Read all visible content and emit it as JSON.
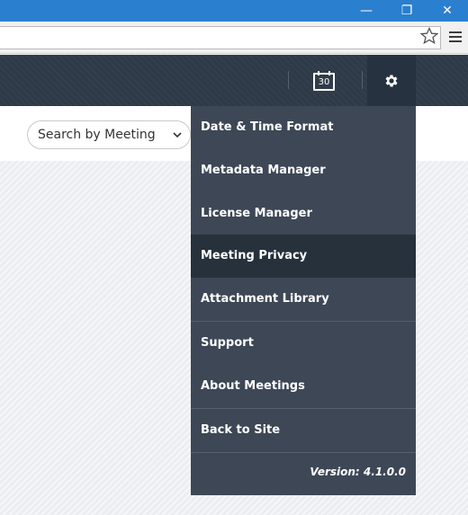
{
  "window": {
    "minimize_glyph": "—",
    "restore_glyph": "❐",
    "close_glyph": "✕"
  },
  "browser": {
    "star_icon": "star-icon",
    "menu_icon": "hamburger-menu-icon"
  },
  "header": {
    "calendar_day": "30",
    "settings_icon": "gear-icon"
  },
  "filter": {
    "search_label": "Search by Meeting"
  },
  "settings_menu": {
    "items": [
      {
        "label": "Date & Time Format"
      },
      {
        "label": "Metadata Manager"
      },
      {
        "label": "License Manager"
      },
      {
        "label": "Meeting Privacy"
      },
      {
        "label": "Attachment Library"
      },
      {
        "label": "Support"
      },
      {
        "label": "About Meetings"
      },
      {
        "label": "Back to Site"
      }
    ],
    "active_item": "Meeting Privacy",
    "version": "Version: 4.1.0.0"
  },
  "colors": {
    "titlebar": "#2b7fcf",
    "header": "#2e3a48",
    "menu_bg": "#3d4756",
    "menu_active": "#26313c"
  }
}
